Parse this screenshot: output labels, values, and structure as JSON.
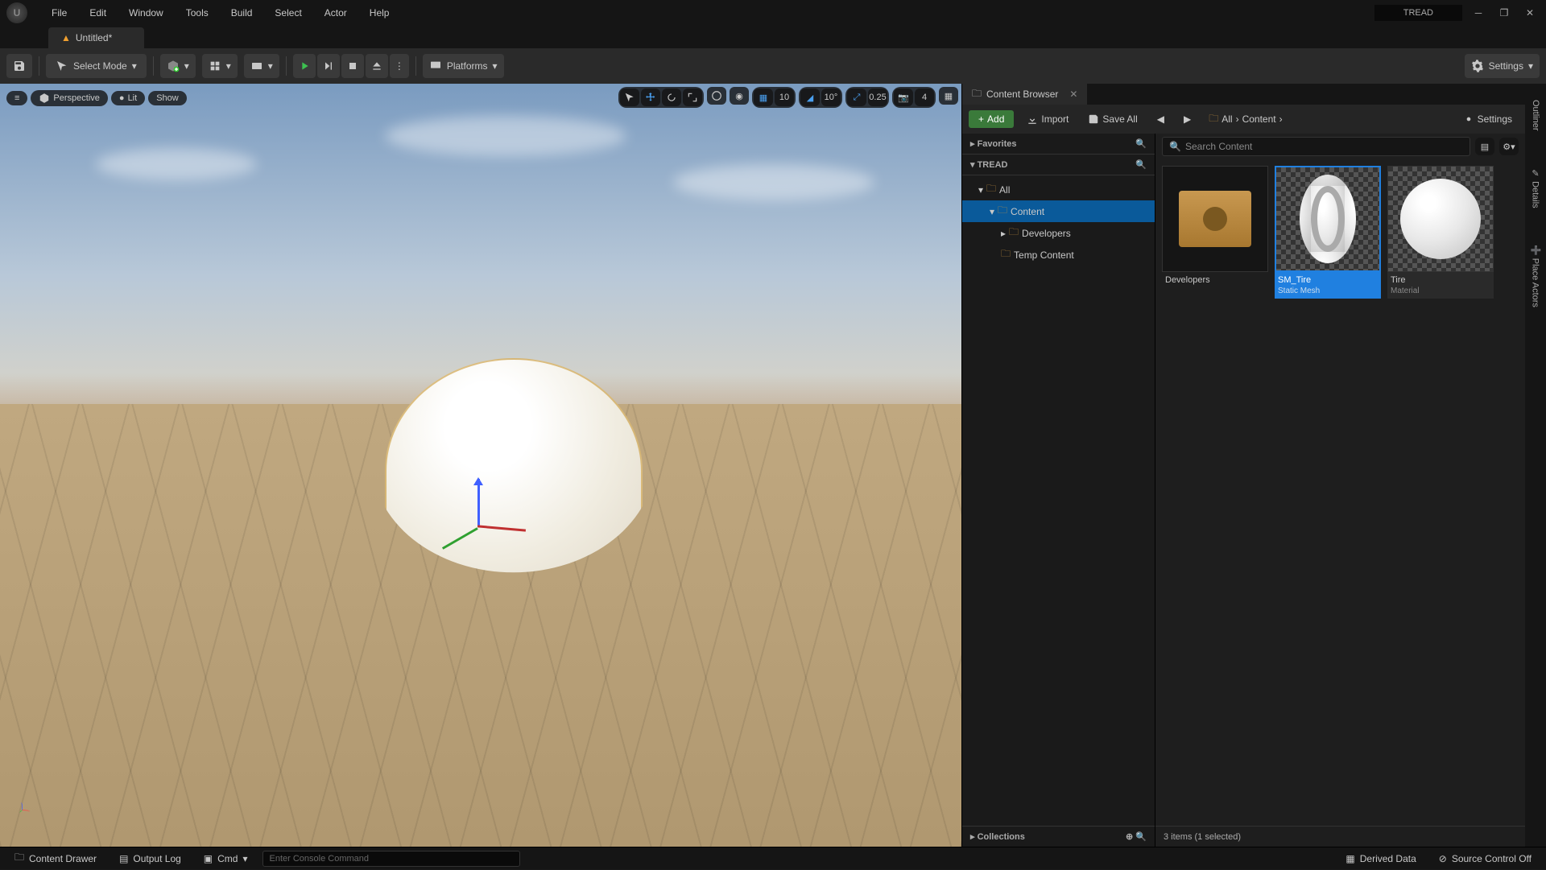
{
  "app": {
    "project_name": "TREAD"
  },
  "menu": {
    "file": "File",
    "edit": "Edit",
    "window": "Window",
    "tools": "Tools",
    "build": "Build",
    "select": "Select",
    "actor": "Actor",
    "help": "Help"
  },
  "tab": {
    "title": "Untitled*"
  },
  "toolbar": {
    "select_mode": "Select Mode",
    "platforms": "Platforms",
    "settings": "Settings"
  },
  "viewport": {
    "menu": "≡",
    "view_mode": "Perspective",
    "lit": "Lit",
    "show": "Show",
    "grid_snap": "10",
    "angle_snap": "10°",
    "scale_snap": "0.25",
    "cam_speed": "4"
  },
  "content_browser": {
    "tab_title": "Content Browser",
    "add": "Add",
    "import": "Import",
    "save_all": "Save All",
    "breadcrumb_all": "All",
    "breadcrumb_content": "Content",
    "settings": "Settings",
    "search_placeholder": "Search Content",
    "favorites": "Favorites",
    "project_name": "TREAD",
    "tree": {
      "all": "All",
      "content": "Content",
      "developers": "Developers",
      "temp": "Temp Content"
    },
    "collections": "Collections",
    "items_status": "3 items (1 selected)",
    "assets": [
      {
        "name": "Developers",
        "type": "",
        "kind": "folder"
      },
      {
        "name": "SM_Tire",
        "type": "Static Mesh",
        "kind": "mesh",
        "selected": true
      },
      {
        "name": "Tire",
        "type": "Material",
        "kind": "material"
      }
    ]
  },
  "right_tabs": {
    "outliner": "Outliner",
    "details": "Details",
    "place_actors": "Place Actors"
  },
  "status": {
    "content_drawer": "Content Drawer",
    "output_log": "Output Log",
    "cmd": "Cmd",
    "console_placeholder": "Enter Console Command",
    "derived_data": "Derived Data",
    "source_control": "Source Control Off"
  }
}
